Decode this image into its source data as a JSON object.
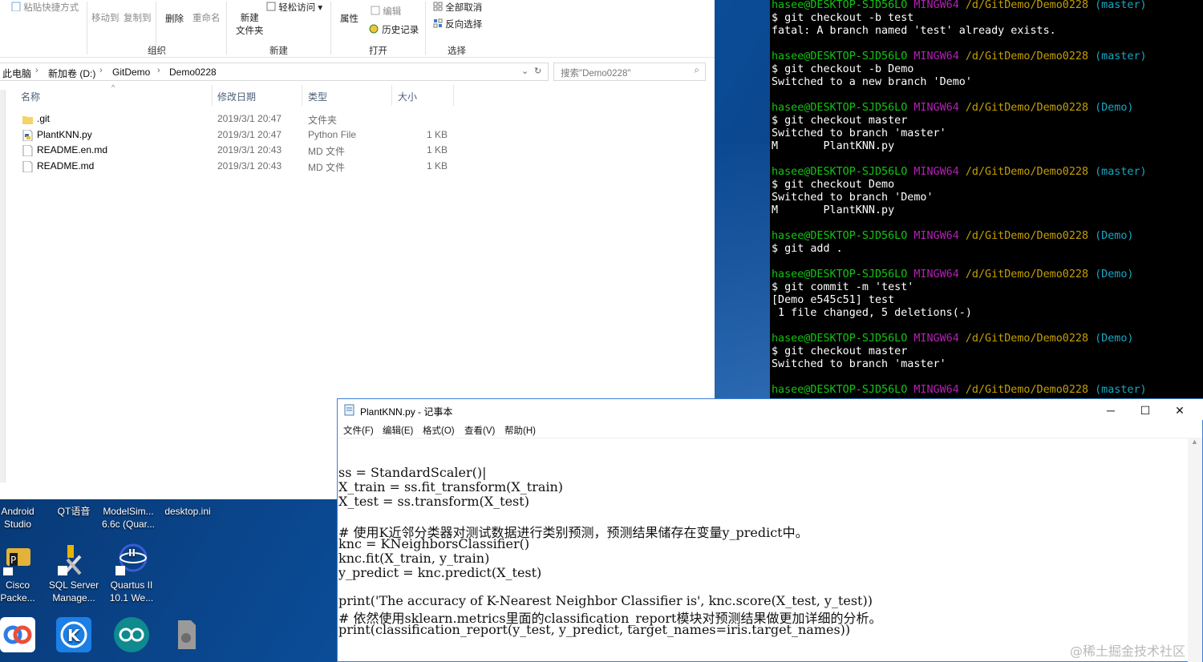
{
  "explorer": {
    "ribbon": {
      "paste_shortcut": "粘贴快捷方式",
      "move_to": "移动到",
      "copy_to": "复制到",
      "delete": "删除",
      "rename": "重命名",
      "new_folder_line1": "新建",
      "new_folder_line2": "文件夹",
      "easy_access": "轻松访问",
      "properties": "属性",
      "edit": "编辑",
      "history": "历史记录",
      "select_none": "全部取消",
      "invert_selection": "反向选择",
      "group_organize": "组织",
      "group_new": "新建",
      "group_open": "打开",
      "group_select": "选择"
    },
    "breadcrumb": [
      "此电脑",
      "新加卷 (D:)",
      "GitDemo",
      "Demo0228"
    ],
    "search_placeholder": "搜索\"Demo0228\"",
    "columns": {
      "name": "名称",
      "modified": "修改日期",
      "type": "类型",
      "size": "大小"
    },
    "files": [
      {
        "name": ".git",
        "modified": "2019/3/1 20:47",
        "type": "文件夹",
        "size": "",
        "icon": "folder-icon"
      },
      {
        "name": "PlantKNN.py",
        "modified": "2019/3/1 20:47",
        "type": "Python File",
        "size": "1 KB",
        "icon": "python-file-icon"
      },
      {
        "name": "README.en.md",
        "modified": "2019/3/1 20:43",
        "type": "MD 文件",
        "size": "1 KB",
        "icon": "md-file-icon"
      },
      {
        "name": "README.md",
        "modified": "2019/3/1 20:43",
        "type": "MD 文件",
        "size": "1 KB",
        "icon": "md-file-icon"
      }
    ]
  },
  "terminal": {
    "prompt_user": "hasee@DESKTOP-SJD56LO",
    "prompt_mingw": "MINGW64",
    "prompt_path": "/d/GitDemo/Demo0228",
    "lines": [
      {
        "kind": "prompt",
        "branch": "(master)"
      },
      {
        "kind": "text",
        "text": "$ git checkout -b test"
      },
      {
        "kind": "text",
        "text": "fatal: A branch named 'test' already exists."
      },
      {
        "kind": "blank"
      },
      {
        "kind": "prompt",
        "branch": "(master)"
      },
      {
        "kind": "text",
        "text": "$ git checkout -b Demo"
      },
      {
        "kind": "text",
        "text": "Switched to a new branch 'Demo'"
      },
      {
        "kind": "blank"
      },
      {
        "kind": "prompt",
        "branch": "(Demo)"
      },
      {
        "kind": "text",
        "text": "$ git checkout master"
      },
      {
        "kind": "text",
        "text": "Switched to branch 'master'"
      },
      {
        "kind": "text",
        "text": "M       PlantKNN.py"
      },
      {
        "kind": "blank"
      },
      {
        "kind": "prompt",
        "branch": "(master)"
      },
      {
        "kind": "text",
        "text": "$ git checkout Demo"
      },
      {
        "kind": "text",
        "text": "Switched to branch 'Demo'"
      },
      {
        "kind": "text",
        "text": "M       PlantKNN.py"
      },
      {
        "kind": "blank"
      },
      {
        "kind": "prompt",
        "branch": "(Demo)"
      },
      {
        "kind": "text",
        "text": "$ git add ."
      },
      {
        "kind": "blank"
      },
      {
        "kind": "prompt",
        "branch": "(Demo)"
      },
      {
        "kind": "text",
        "text": "$ git commit -m 'test'"
      },
      {
        "kind": "text",
        "text": "[Demo e545c51] test"
      },
      {
        "kind": "text",
        "text": " 1 file changed, 5 deletions(-)"
      },
      {
        "kind": "blank"
      },
      {
        "kind": "prompt",
        "branch": "(Demo)"
      },
      {
        "kind": "text",
        "text": "$ git checkout master"
      },
      {
        "kind": "text",
        "text": "Switched to branch 'master'"
      },
      {
        "kind": "blank"
      },
      {
        "kind": "prompt",
        "branch": "(master)"
      }
    ],
    "colors": {
      "user": "#14c414",
      "mingw": "#b61fb6",
      "path": "#c4a000",
      "branch": "#17a8c4"
    }
  },
  "notepad": {
    "title": "PlantKNN.py - 记事本",
    "menu": [
      "文件(F)",
      "编辑(E)",
      "格式(O)",
      "查看(V)",
      "帮助(H)"
    ],
    "code_lines": [
      "",
      "ss = StandardScaler()|",
      "X_train = ss.fit_transform(X_train)",
      "X_test = ss.transform(X_test)",
      "",
      "# 使用K近邻分类器对测试数据进行类别预测，预测结果储存在变量y_predict中。",
      "knc = KNeighborsClassifier()",
      "knc.fit(X_train, y_train)",
      "y_predict = knc.predict(X_test)",
      "",
      "print('The accuracy of K-Nearest Neighbor Classifier is', knc.score(X_test, y_test))",
      "# 依然使用sklearn.metrics里面的classification_report模块对预测结果做更加详细的分析。",
      "print(classification_report(y_test, y_predict, target_names=iris.target_names))"
    ]
  },
  "desktop_icons": [
    {
      "label1": "Android",
      "label2": "Studio"
    },
    {
      "label1": "QT语音",
      "label2": ""
    },
    {
      "label1": "ModelSim...",
      "label2": "6.6c (Quar..."
    },
    {
      "label1": "desktop.ini",
      "label2": ""
    },
    {
      "label1": "Cisco",
      "label2": "Packe..."
    },
    {
      "label1": "SQL Server",
      "label2": "Manage..."
    },
    {
      "label1": "Quartus II",
      "label2": "10.1 We..."
    }
  ],
  "watermark": "@稀土掘金技术社区"
}
